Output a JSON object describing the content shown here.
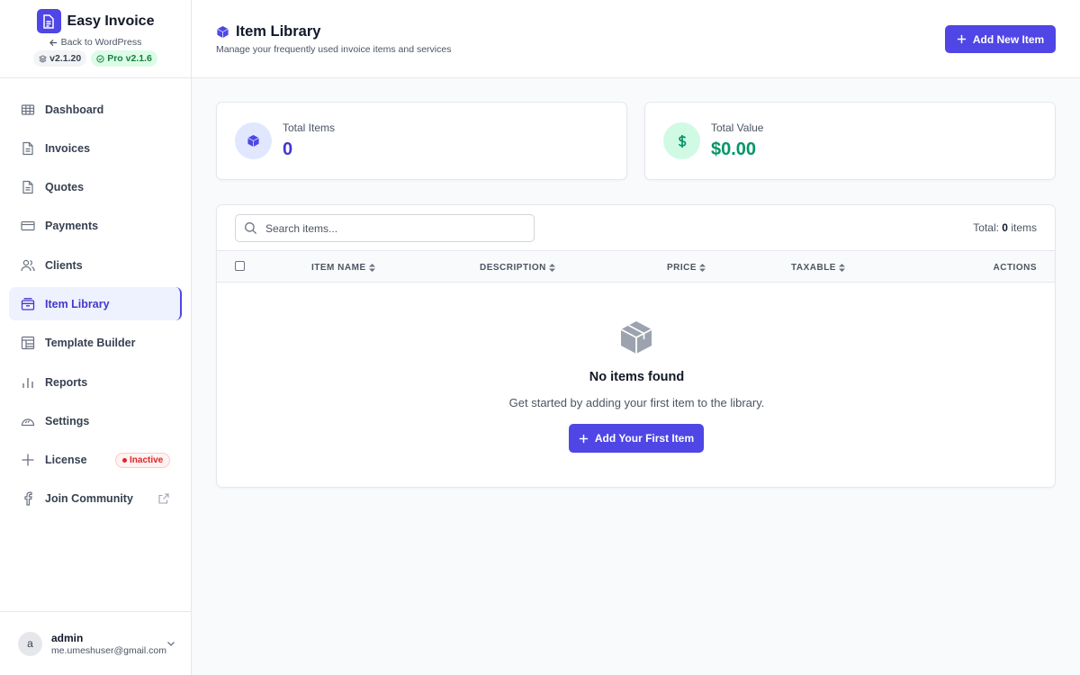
{
  "brand": {
    "name": "Easy Invoice",
    "back_link": "Back to WordPress",
    "version": "v2.1.20",
    "pro_version": "Pro v2.1.6"
  },
  "nav": {
    "items": [
      {
        "label": "Dashboard",
        "icon": "grid-icon"
      },
      {
        "label": "Invoices",
        "icon": "document-icon"
      },
      {
        "label": "Quotes",
        "icon": "document-icon"
      },
      {
        "label": "Payments",
        "icon": "credit-card-icon"
      },
      {
        "label": "Clients",
        "icon": "users-icon"
      },
      {
        "label": "Item Library",
        "icon": "archive-icon",
        "active": true
      },
      {
        "label": "Template Builder",
        "icon": "layout-icon"
      },
      {
        "label": "Reports",
        "icon": "bar-chart-icon"
      },
      {
        "label": "Settings",
        "icon": "cloud-icon"
      },
      {
        "label": "License",
        "icon": "sparkle-icon",
        "badge": "Inactive"
      },
      {
        "label": "Join Community",
        "icon": "facebook-icon"
      }
    ]
  },
  "user": {
    "avatar_letter": "a",
    "name": "admin",
    "email": "me.umeshuser@gmail.com"
  },
  "header": {
    "title": "Item Library",
    "subtitle": "Manage your frequently used invoice items and services",
    "add_button": "Add New Item"
  },
  "stats": {
    "total_items": {
      "label": "Total Items",
      "value": "0"
    },
    "total_value": {
      "label": "Total Value",
      "value": "$0.00"
    }
  },
  "table": {
    "search_placeholder": "Search items...",
    "total_prefix": "Total:",
    "total_count": "0",
    "total_suffix": "items",
    "columns": [
      "ITEM NAME",
      "DESCRIPTION",
      "PRICE",
      "TAXABLE",
      "ACTIONS"
    ]
  },
  "empty": {
    "title": "No items found",
    "subtitle": "Get started by adding your first item to the library.",
    "button": "Add Your First Item"
  },
  "colors": {
    "accent": "#4f46e5",
    "success": "#059669",
    "danger": "#dc2626"
  }
}
